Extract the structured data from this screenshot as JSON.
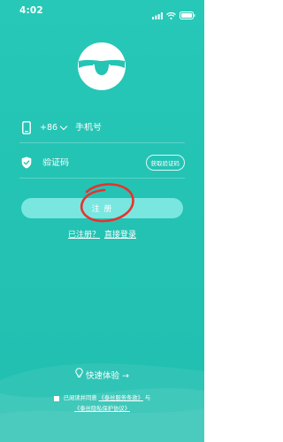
{
  "status_bar": {
    "time": "4:02"
  },
  "logo": {
    "icon": "smile-logo-icon"
  },
  "phone_field": {
    "icon": "phone-icon",
    "country_code": "+86",
    "placeholder": "手机号"
  },
  "code_field": {
    "icon": "shield-check-icon",
    "placeholder": "验证码",
    "get_code_label": "获取验证码"
  },
  "register_button": {
    "label": "注 册"
  },
  "login_prompt": {
    "prefix": "已注册？",
    "link": "直接登录"
  },
  "quick_experience": {
    "label": "快速体验 →",
    "icon": "lightbulb-icon"
  },
  "agreement": {
    "prefix": "已阅读并同意",
    "terms_link": "《泰丝服务条款》",
    "conjunction": "与",
    "privacy_link": "《泰丝隐私保护协议》"
  },
  "colors": {
    "background": "#25c4b5",
    "button": "#7ae6e0",
    "annotation": "#e8322f"
  }
}
